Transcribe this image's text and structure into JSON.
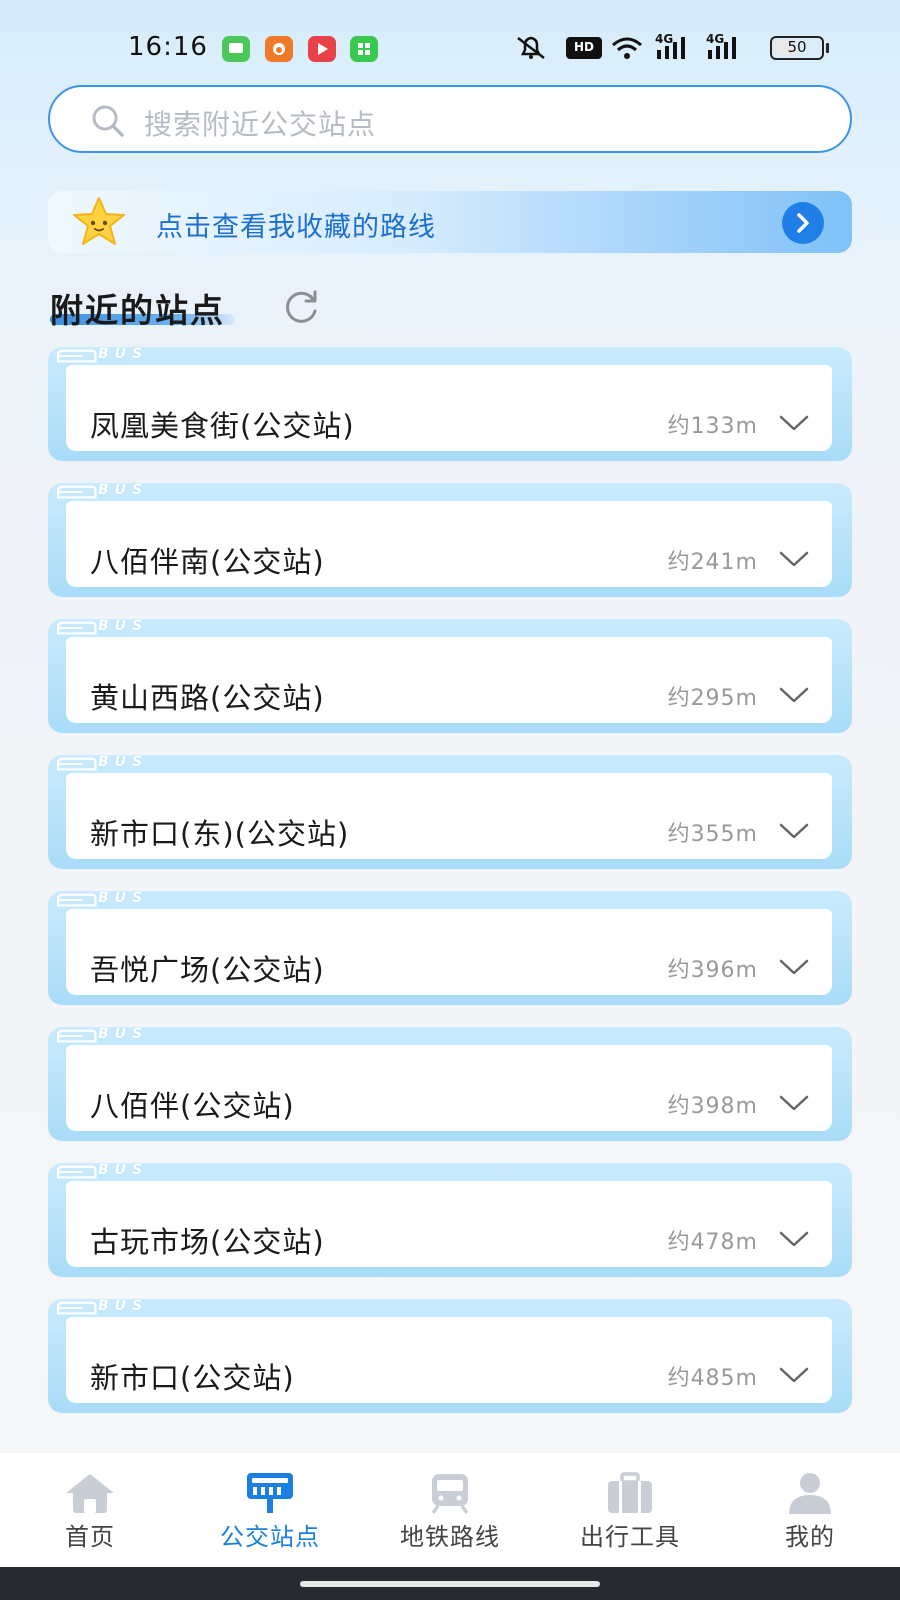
{
  "status_bar": {
    "time": "16:16",
    "hd_badge": "HD",
    "signal_1": "4G",
    "signal_2": "4G",
    "battery": "50",
    "battery_level": 0.5
  },
  "search": {
    "placeholder": "搜索附近公交站点"
  },
  "favorites_banner": {
    "text": "点击查看我收藏的路线"
  },
  "section": {
    "title": "附近的站点"
  },
  "bus_tag": "BUS",
  "stations": [
    {
      "name": "凤凰美食街(公交站)",
      "distance": "约133m"
    },
    {
      "name": "八佰伴南(公交站)",
      "distance": "约241m"
    },
    {
      "name": "黄山西路(公交站)",
      "distance": "约295m"
    },
    {
      "name": "新市口(东)(公交站)",
      "distance": "约355m"
    },
    {
      "name": "吾悦广场(公交站)",
      "distance": "约396m"
    },
    {
      "name": "八佰伴(公交站)",
      "distance": "约398m"
    },
    {
      "name": "古玩市场(公交站)",
      "distance": "约478m"
    },
    {
      "name": "新市口(公交站)",
      "distance": "约485m"
    }
  ],
  "bottom_nav": [
    {
      "label": "首页",
      "icon": "home-icon",
      "active": false
    },
    {
      "label": "公交站点",
      "icon": "bus-stop-icon",
      "active": true
    },
    {
      "label": "地铁路线",
      "icon": "metro-icon",
      "active": false
    },
    {
      "label": "出行工具",
      "icon": "toolbox-icon",
      "active": false
    },
    {
      "label": "我的",
      "icon": "profile-icon",
      "active": false
    }
  ],
  "colors": {
    "accent": "#1a7fe0",
    "search_border": "#3b94e8",
    "card_frame": "#a8dcf8",
    "inactive_icon": "#c9ced6"
  }
}
